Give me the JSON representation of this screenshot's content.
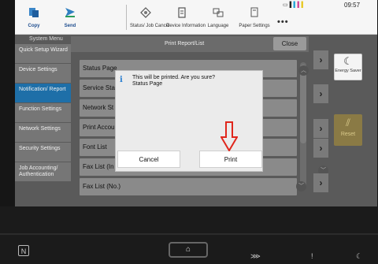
{
  "topbar": {
    "copy_label": "Copy",
    "send_label": "Send",
    "status_label": "Status/ Job Cancel",
    "device_label": "Device Information",
    "language_label": "Language",
    "paper_label": "Paper Settings",
    "more_label": "•••",
    "time": "09:57"
  },
  "sidebar": {
    "title": "System Menu",
    "items": [
      {
        "label": "Quick Setup Wizard"
      },
      {
        "label": "Device Settings"
      },
      {
        "label": "Notification/ Report"
      },
      {
        "label": "Function Settings"
      },
      {
        "label": "Network Settings"
      },
      {
        "label": "Security Settings"
      },
      {
        "label": "Job Accounting/ Authentication"
      }
    ]
  },
  "panel": {
    "title": "Print Report/List",
    "close_label": "Close",
    "rows": [
      {
        "label": "Status Page"
      },
      {
        "label": "Service Sta"
      },
      {
        "label": "Network St"
      },
      {
        "label": "Print Accou"
      },
      {
        "label": "Font List"
      },
      {
        "label": "Fax List (In"
      },
      {
        "label": "Fax List (No.)"
      }
    ]
  },
  "dialog": {
    "message_line1": "This will be printed. Are you sure?",
    "message_line2": "Status Page",
    "cancel_label": "Cancel",
    "print_label": "Print"
  },
  "side": {
    "energy_label": "Energy Saver",
    "reset_label": "Reset"
  },
  "bottom": {
    "home_icon": "⌂"
  },
  "colors": {
    "active_menu": "#1e6fa8",
    "info_icon": "#2a7fd0",
    "arrow": "#e0261c",
    "reset": "#8a7a45"
  }
}
